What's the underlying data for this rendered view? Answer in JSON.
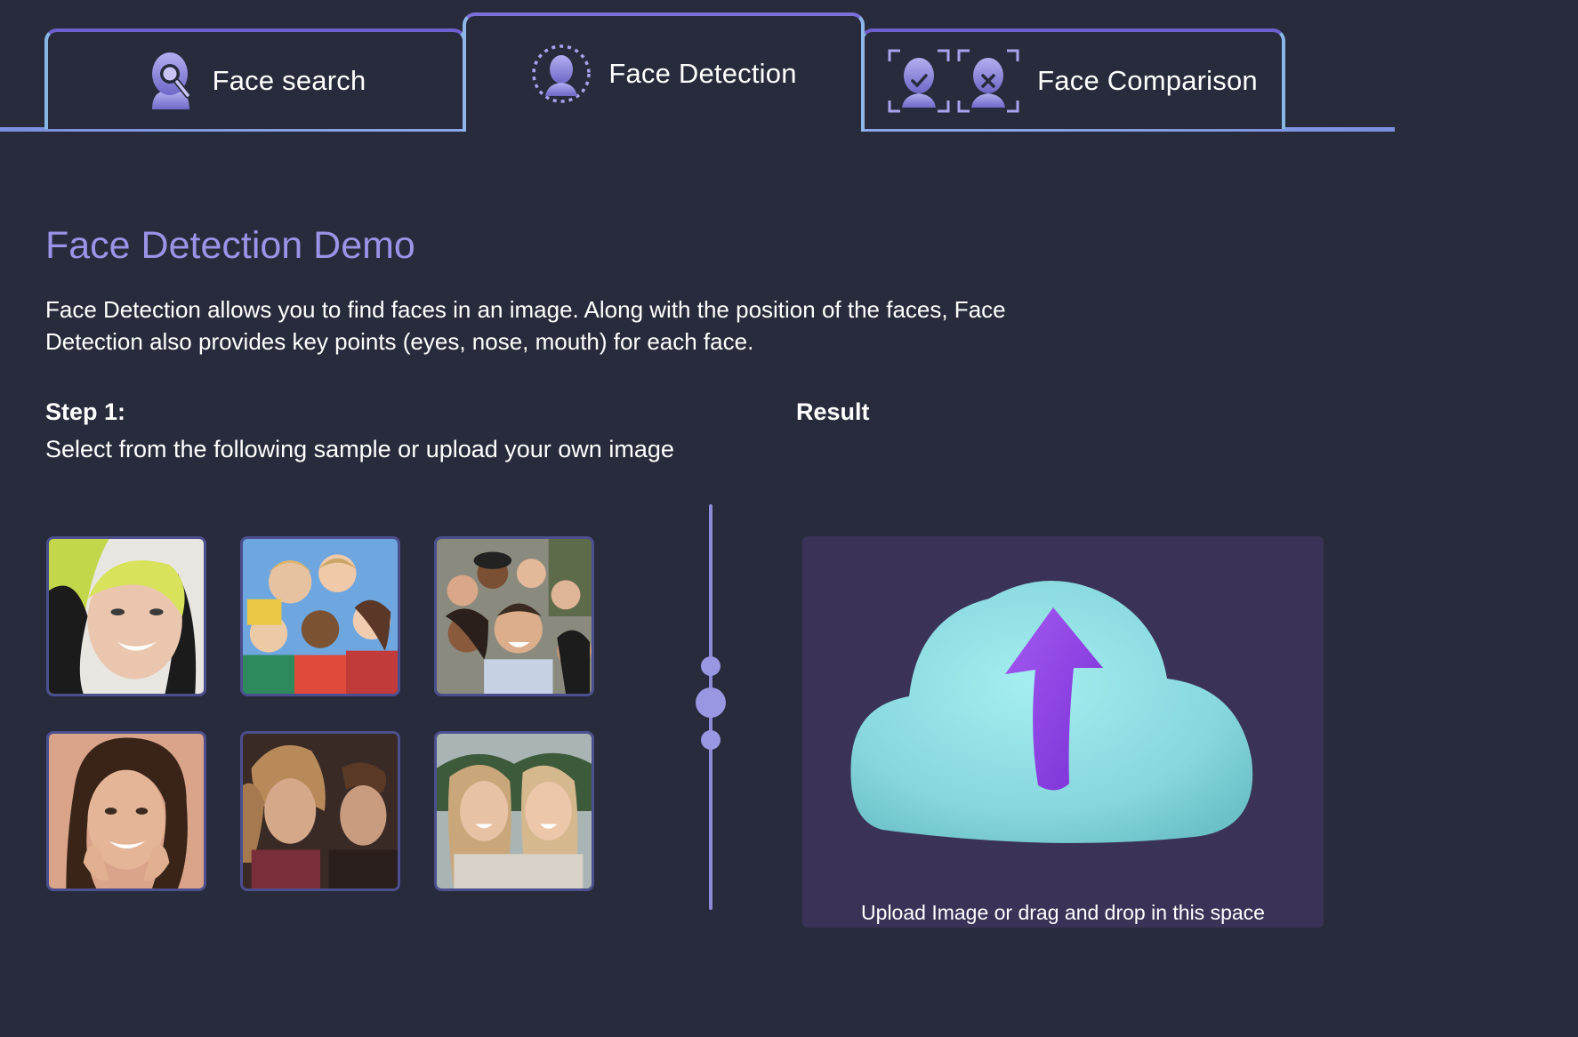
{
  "tabs": [
    {
      "label": "Face search",
      "icon": "face-search-icon",
      "active": false
    },
    {
      "label": "Face Detection",
      "icon": "face-detection-icon",
      "active": true
    },
    {
      "label": "Face Comparison",
      "icon": "face-comparison-icon",
      "active": false
    }
  ],
  "main": {
    "title": "Face Detection Demo",
    "description": "Face Detection allows you to find faces in an image. Along with the position of the faces, Face Detection also provides key points (eyes, nose, mouth) for each face.",
    "step": {
      "heading": "Step 1:",
      "instruction": "Select from the following sample or upload your own image"
    },
    "result_heading": "Result"
  },
  "samples": [
    {
      "name": "sample-1",
      "subject": "woman with green and black hair smiling"
    },
    {
      "name": "sample-2",
      "subject": "group of children giving thumbs up"
    },
    {
      "name": "sample-3",
      "subject": "group of friends taking selfie"
    },
    {
      "name": "sample-4",
      "subject": "woman smiling with hands on cheeks"
    },
    {
      "name": "sample-5",
      "subject": "two men portrait"
    },
    {
      "name": "sample-6",
      "subject": "two young women outdoors"
    }
  ],
  "upload": {
    "text": "Upload Image or drag and drop in this space",
    "icon": "cloud-upload-icon"
  },
  "colors": {
    "background": "#282b3b",
    "accent": "#9b93e8",
    "tab_border": "#6c63c9",
    "upload_panel": "#3a3357",
    "cloud": "#8cdbe0",
    "arrow": "#8a3fe0"
  }
}
